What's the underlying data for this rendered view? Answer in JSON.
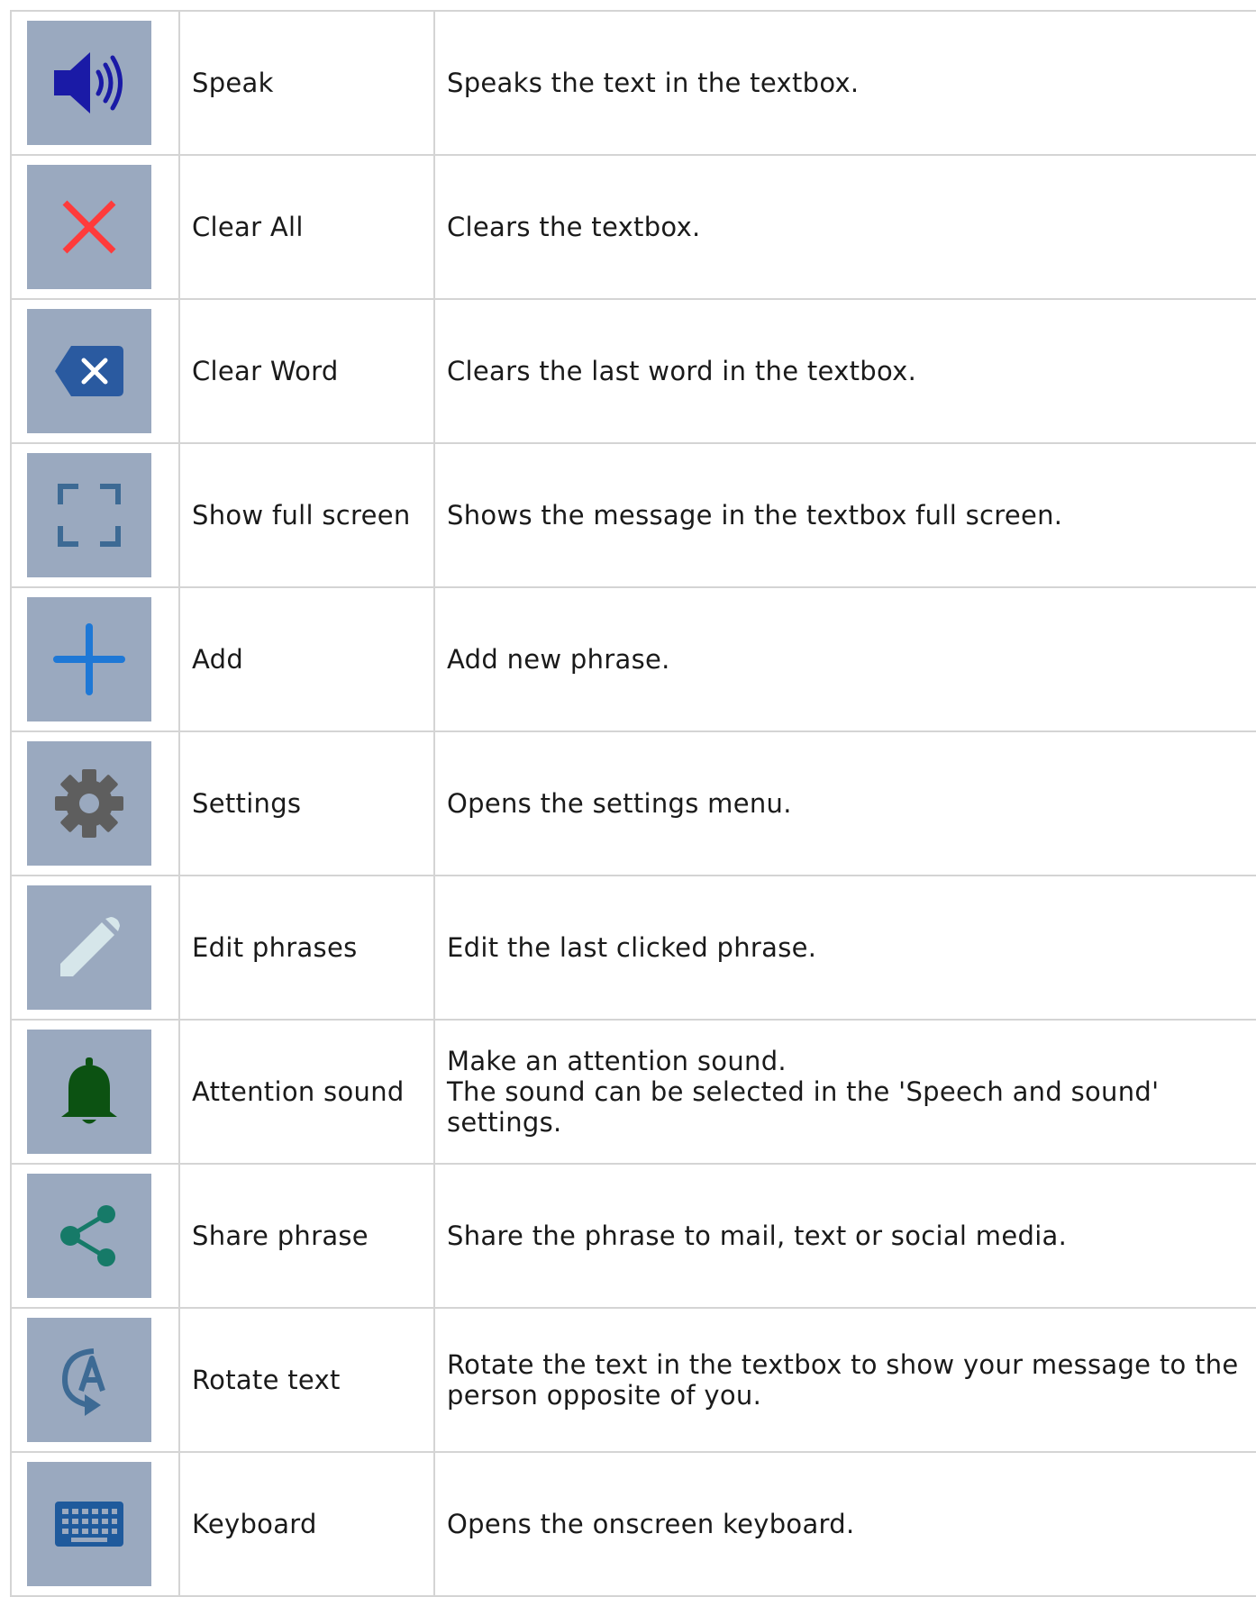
{
  "colors": {
    "tile_bg": "#9aa9bf",
    "speaker": "#1a1aa6",
    "clear_all": "#ff3b3b",
    "clear_word": "#2a5aa0",
    "fullscreen": "#3d6a94",
    "add": "#1e78d6",
    "settings": "#5e5e5e",
    "edit": "#d6e6ea",
    "bell": "#0c5212",
    "share": "#167a68",
    "rotate": "#3d6a94",
    "keyboard": "#1f5a9c"
  },
  "rows": [
    {
      "icon": "speaker-icon",
      "name": "Speak",
      "desc": [
        "Speaks the text in the textbox."
      ]
    },
    {
      "icon": "close-icon",
      "name": "Clear All",
      "desc": [
        "Clears the textbox."
      ]
    },
    {
      "icon": "backspace-icon",
      "name": "Clear Word",
      "desc": [
        "Clears the last word in the textbox."
      ]
    },
    {
      "icon": "fullscreen-icon",
      "name": "Show full screen",
      "desc": [
        "Shows the message in the textbox full screen."
      ]
    },
    {
      "icon": "plus-icon",
      "name": "Add",
      "desc": [
        "Add new phrase."
      ]
    },
    {
      "icon": "gear-icon",
      "name": "Settings",
      "desc": [
        "Opens the settings menu."
      ]
    },
    {
      "icon": "pencil-icon",
      "name": "Edit phrases",
      "desc": [
        "Edit the last clicked phrase."
      ]
    },
    {
      "icon": "bell-icon",
      "name": "Attention sound",
      "desc": [
        "Make an attention sound.",
        "The sound can be selected in the 'Speech and sound' settings."
      ]
    },
    {
      "icon": "share-icon",
      "name": "Share phrase",
      "desc": [
        "Share the phrase to mail, text or social media."
      ]
    },
    {
      "icon": "rotate-text-icon",
      "name": "Rotate text",
      "desc": [
        "Rotate the text in the textbox to show your message to the",
        "person opposite of you."
      ]
    },
    {
      "icon": "keyboard-icon",
      "name": "Keyboard",
      "desc": [
        "Opens the onscreen keyboard."
      ]
    }
  ]
}
